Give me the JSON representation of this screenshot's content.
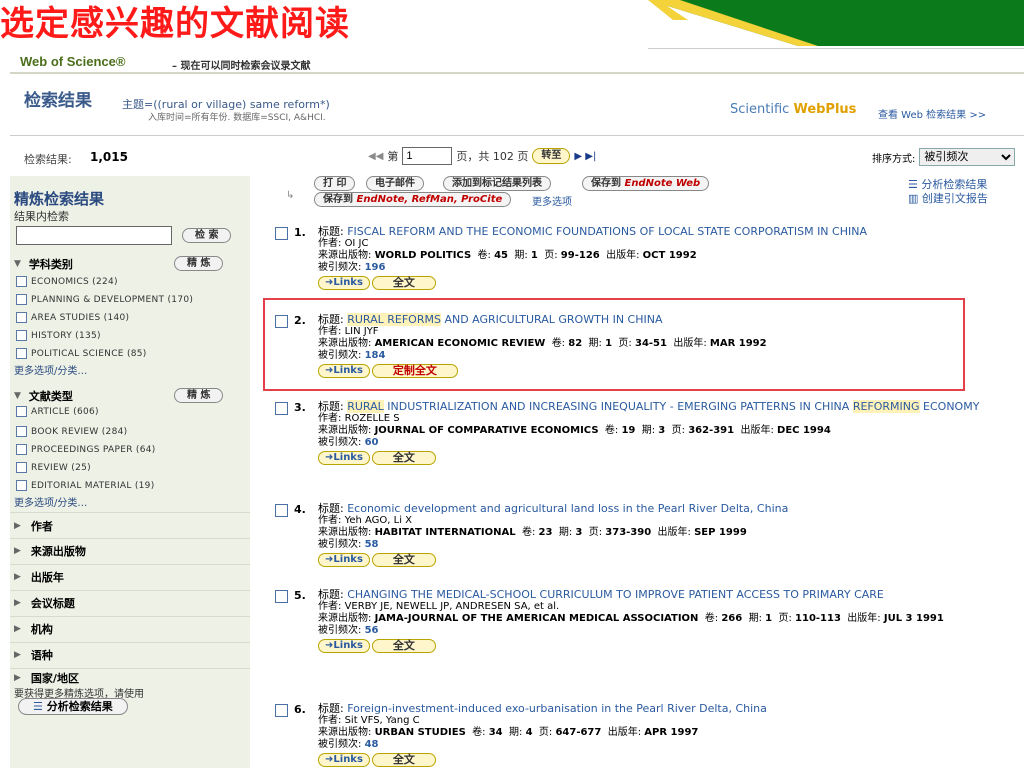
{
  "slide": {
    "title": "选定感兴趣的文献阅读"
  },
  "colors": {
    "title_red": "#ff1a1a",
    "deco_green": "#0a7a1a",
    "deco_yellow": "#f3d23a",
    "highlight": "#e3404a"
  },
  "wos": {
    "brand": "Web of Science®",
    "subtitle": "– 现在可以同时检索会议录文献"
  },
  "result_header": {
    "title": "检索结果",
    "query": "主题=((rural or village) same reform*)",
    "query_sub": "入库时间=所有年份. 数据库=SSCI, A&HCI.",
    "webplus_left": "Scientific ",
    "webplus_right": "WebPlus",
    "webplus_link": "查看 Web 检索结果 >>"
  },
  "pager": {
    "count_label": "检索结果:",
    "count_value": "1,015",
    "page_prefix": "第",
    "page_value": "1",
    "page_suffix": "页，共 102 页",
    "goto_label": "转至",
    "sort_label": "排序方式:",
    "sort_value": "被引频次"
  },
  "sidebar": {
    "heading": "精炼检索结果",
    "sub": "结果内检索",
    "search_btn": "检 索",
    "refine_label": "精 炼",
    "subject_head": "学科类别",
    "subjects": [
      "ECONOMICS (224)",
      "PLANNING & DEVELOPMENT (170)",
      "AREA STUDIES (140)",
      "HISTORY (135)",
      "POLITICAL SCIENCE (85)"
    ],
    "more": "更多选项/分类…",
    "doctype_head": "文献类型",
    "doctypes": [
      "ARTICLE (606)",
      "BOOK REVIEW (284)",
      "PROCEEDINGS PAPER (64)",
      "REVIEW (25)",
      "EDITORIAL MATERIAL (19)"
    ],
    "facets": [
      "作者",
      "来源出版物",
      "出版年",
      "会议标题",
      "机构",
      "语种",
      "国家/地区"
    ],
    "hint": "要获得更多精炼选项，请使用",
    "analyze_btn": "分析检索结果"
  },
  "actions": {
    "print": "打 印",
    "email": "电子邮件",
    "add_marked": "添加到标记结果列表",
    "save_to": "保存到",
    "endnote_web": "EndNote Web",
    "save_to2": "保存到",
    "endnote_list": "EndNote, RefMan, ProCite",
    "more_options": "更多选项",
    "analyze_results": "分析检索结果",
    "citation_report": "创建引文报告"
  },
  "labels": {
    "title": "标题:",
    "author": "作者:",
    "source": "来源出版物:",
    "volume": "卷:",
    "issue": "期:",
    "pages": "页:",
    "pubdate": "出版年:",
    "cited": "被引频次:",
    "links": "Links",
    "fulltext": "全文",
    "order_fulltext": "定制全文"
  },
  "records": [
    {
      "num": "1.",
      "title_pre": "",
      "title_hl": "",
      "title_rest": "FISCAL REFORM AND THE ECONOMIC FOUNDATIONS OF LOCAL STATE CORPORATISM IN CHINA",
      "author": "OI JC",
      "source": "WORLD POLITICS",
      "volume": "45",
      "issue": "1",
      "pages": "99-126",
      "date": "OCT 1992",
      "cites": "196"
    },
    {
      "num": "2.",
      "title_pre": "",
      "title_hl": "RURAL REFORMS",
      "title_rest": " AND AGRICULTURAL GROWTH IN CHINA",
      "author": "LIN JYF",
      "source": "AMERICAN ECONOMIC REVIEW",
      "volume": "82",
      "issue": "1",
      "pages": "34-51",
      "date": "MAR 1992",
      "cites": "184"
    },
    {
      "num": "3.",
      "title_pre": "",
      "title_hl": "RURAL",
      "title_rest": " INDUSTRIALIZATION AND INCREASING INEQUALITY - EMERGING PATTERNS IN CHINA ",
      "title_hl2": "REFORMING",
      "title_rest2": " ECONOMY",
      "author": "ROZELLE S",
      "source": "JOURNAL OF COMPARATIVE ECONOMICS",
      "volume": "19",
      "issue": "3",
      "pages": "362-391",
      "date": "DEC 1994",
      "cites": "60"
    },
    {
      "num": "4.",
      "title_pre": "",
      "title_hl": "",
      "title_rest": "Economic development and agricultural land loss in the Pearl River Delta, China",
      "author": "Yeh AGO, Li X",
      "source": "HABITAT INTERNATIONAL",
      "volume": "23",
      "issue": "3",
      "pages": "373-390",
      "date": "SEP 1999",
      "cites": "58"
    },
    {
      "num": "5.",
      "title_pre": "",
      "title_hl": "",
      "title_rest": "CHANGING THE MEDICAL-SCHOOL CURRICULUM TO IMPROVE PATIENT ACCESS TO PRIMARY CARE",
      "author": "VERBY JE, NEWELL JP, ANDRESEN SA, et al.",
      "source": "JAMA-JOURNAL OF THE AMERICAN MEDICAL ASSOCIATION",
      "volume": "266",
      "issue": "1",
      "pages": "110-113",
      "date": "JUL 3 1991",
      "cites": "56"
    },
    {
      "num": "6.",
      "title_pre": "",
      "title_hl": "",
      "title_rest": "Foreign-investment-induced exo-urbanisation in the Pearl River Delta, China",
      "author": "Sit VFS, Yang C",
      "source": "URBAN STUDIES",
      "volume": "34",
      "issue": "4",
      "pages": "647-677",
      "date": "APR 1997",
      "cites": "48"
    }
  ]
}
